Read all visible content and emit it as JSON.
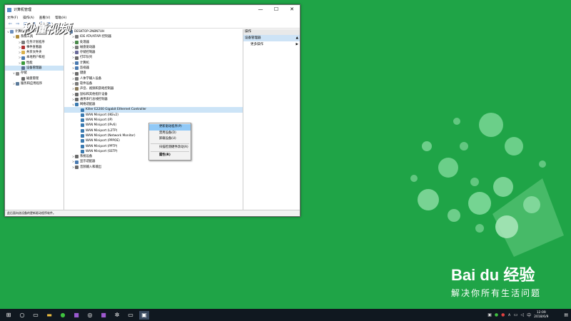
{
  "window": {
    "title": "计算机管理",
    "controls": [
      "—",
      "☐",
      "✕"
    ]
  },
  "menubar": [
    "文件(F)",
    "操作(A)",
    "查看(V)",
    "帮助(H)"
  ],
  "watermark": "秒懂视频",
  "tree": [
    {
      "exp": "∨",
      "label": "计算机管理(本地)",
      "indent": 0,
      "color": "#6b8fbf"
    },
    {
      "exp": "∨",
      "label": "系统工具",
      "indent": 1,
      "color": "#b08c3c"
    },
    {
      "exp": ">",
      "label": "任务计划程序",
      "indent": 2,
      "color": "#7a7a7a"
    },
    {
      "exp": ">",
      "label": "事件查看器",
      "indent": 2,
      "color": "#b03030"
    },
    {
      "exp": ">",
      "label": "共享文件夹",
      "indent": 2,
      "color": "#d9b04a"
    },
    {
      "exp": ">",
      "label": "本地用户和组",
      "indent": 2,
      "color": "#4a7ab0"
    },
    {
      "exp": ">",
      "label": "性能",
      "indent": 2,
      "color": "#3a9a3a"
    },
    {
      "exp": "",
      "label": "设备管理器",
      "indent": 2,
      "color": "#5a6f8f",
      "selected": true
    },
    {
      "exp": "∨",
      "label": "存储",
      "indent": 1,
      "color": "#8a8a8a"
    },
    {
      "exp": "",
      "label": "磁盘管理",
      "indent": 2,
      "color": "#6a6a6a"
    },
    {
      "exp": ">",
      "label": "服务和应用程序",
      "indent": 1,
      "color": "#5a7a9a"
    }
  ],
  "devices": [
    {
      "exp": "∨",
      "label": "DESKTOP-2N8N7UH",
      "indent": 0,
      "color": "#5a7aa0"
    },
    {
      "exp": ">",
      "label": "IDE ATA/ATAPI 控制器",
      "indent": 1,
      "color": "#7a7a7a"
    },
    {
      "exp": ">",
      "label": "处理器",
      "indent": 1,
      "color": "#4a8a4a"
    },
    {
      "exp": ">",
      "label": "磁盘驱动器",
      "indent": 1,
      "color": "#7a7a7a"
    },
    {
      "exp": ">",
      "label": "存储控制器",
      "indent": 1,
      "color": "#6a6a9a"
    },
    {
      "exp": ">",
      "label": "打印队列",
      "indent": 1,
      "color": "#6a6a6a"
    },
    {
      "exp": ">",
      "label": "计算机",
      "indent": 1,
      "color": "#4a7ab0"
    },
    {
      "exp": ">",
      "label": "监视器",
      "indent": 1,
      "color": "#4a7ab0"
    },
    {
      "exp": ">",
      "label": "键盘",
      "indent": 1,
      "color": "#6a6a6a"
    },
    {
      "exp": ">",
      "label": "人体学输入设备",
      "indent": 1,
      "color": "#7a7a7a"
    },
    {
      "exp": ">",
      "label": "软件设备",
      "indent": 1,
      "color": "#7a7a7a"
    },
    {
      "exp": ">",
      "label": "声音、视频和游戏控制器",
      "indent": 1,
      "color": "#8a7a5a"
    },
    {
      "exp": ">",
      "label": "鼠标和其他指针设备",
      "indent": 1,
      "color": "#6a6a6a"
    },
    {
      "exp": ">",
      "label": "通用串行总线控制器",
      "indent": 1,
      "color": "#6a6a6a"
    },
    {
      "exp": "∨",
      "label": "网络适配器",
      "indent": 1,
      "color": "#3a7ab0"
    },
    {
      "exp": "",
      "label": "Killer E2200 Gigabit Ethernet Controller",
      "indent": 2,
      "color": "#3a7ab0",
      "selected": true
    },
    {
      "exp": "",
      "label": "WAN Miniport (IKEv2)",
      "indent": 2,
      "color": "#3a7ab0"
    },
    {
      "exp": "",
      "label": "WAN Miniport (IP)",
      "indent": 2,
      "color": "#3a7ab0"
    },
    {
      "exp": "",
      "label": "WAN Miniport (IPv6)",
      "indent": 2,
      "color": "#3a7ab0"
    },
    {
      "exp": "",
      "label": "WAN Miniport (L2TP)",
      "indent": 2,
      "color": "#3a7ab0"
    },
    {
      "exp": "",
      "label": "WAN Miniport (Network Monitor)",
      "indent": 2,
      "color": "#3a7ab0"
    },
    {
      "exp": "",
      "label": "WAN Miniport (PPPOE)",
      "indent": 2,
      "color": "#3a7ab0"
    },
    {
      "exp": "",
      "label": "WAN Miniport (PPTP)",
      "indent": 2,
      "color": "#3a7ab0"
    },
    {
      "exp": "",
      "label": "WAN Miniport (SSTP)",
      "indent": 2,
      "color": "#3a7ab0"
    },
    {
      "exp": ">",
      "label": "系统设备",
      "indent": 1,
      "color": "#6a6a6a"
    },
    {
      "exp": ">",
      "label": "显示适配器",
      "indent": 1,
      "color": "#4a7ab0"
    },
    {
      "exp": ">",
      "label": "音频输入和输出",
      "indent": 1,
      "color": "#6a6a6a"
    }
  ],
  "actions": {
    "header": "操作",
    "selected": "设备管理器",
    "more": "更多操作",
    "arrow_up": "▲",
    "arrow_right": "▶"
  },
  "context_menu": {
    "update": "更新驱动程序(P)",
    "disable": "禁用设备(D)",
    "uninstall": "卸载设备(U)",
    "scan": "扫描检测硬件改动(A)",
    "properties": "属性(R)"
  },
  "status": "此后面向选设备的更新驱动程序软件。",
  "baidu": {
    "logo": "Bai du 经验",
    "slogan": "解决你所有生活问题"
  },
  "taskbar": {
    "time": "12:09",
    "date": "2018/6/9"
  },
  "colors": {
    "desktop": "#1fa447",
    "selection": "#cce4f7",
    "menu_highlight": "#91c9f7"
  }
}
